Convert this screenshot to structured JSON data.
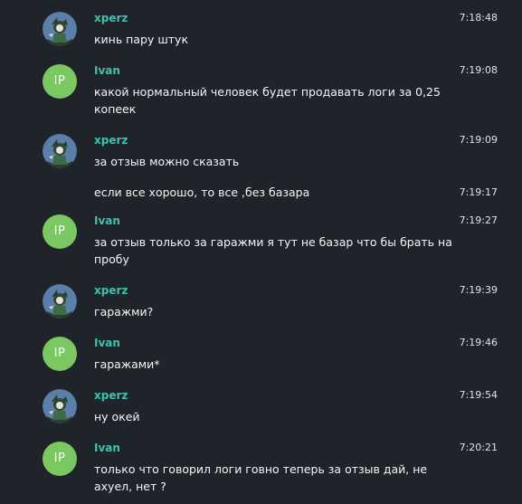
{
  "messages": [
    {
      "sender": "xperz",
      "avatar": "xperz-avatar",
      "time": "7:18:48",
      "text": "кинь пару штук"
    },
    {
      "sender": "Ivan",
      "avatar_initials": "IP",
      "time": "7:19:08",
      "text": "какой нормальный человек будет продавать логи за 0,25 копеек"
    },
    {
      "sender": "xperz",
      "avatar": "xperz-avatar",
      "time": "7:19:09",
      "text": "за отзыв можно сказать"
    },
    {
      "time": "7:19:17",
      "text": "если все хорошо, то все ,без базара"
    },
    {
      "sender": "Ivan",
      "avatar_initials": "IP",
      "time": "7:19:27",
      "text": "за отзыв только за гаражми я тут не базар что бы брать на пробу"
    },
    {
      "sender": "xperz",
      "avatar": "xperz-avatar",
      "time": "7:19:39",
      "text": "гаражми?"
    },
    {
      "sender": "Ivan",
      "avatar_initials": "IP",
      "time": "7:19:46",
      "text": "гаражами*"
    },
    {
      "sender": "xperz",
      "avatar": "xperz-avatar",
      "time": "7:19:54",
      "text": "ну окей"
    },
    {
      "sender": "Ivan",
      "avatar_initials": "IP",
      "time": "7:20:21",
      "text": "только что говорил логи говно теперь за отзыв дай, не ахуел, нет ?"
    }
  ],
  "colors": {
    "background": "#1e2429",
    "sender_name": "#3fc1b0",
    "ip_avatar": "#7bc862",
    "text": "#f5f5f5"
  }
}
